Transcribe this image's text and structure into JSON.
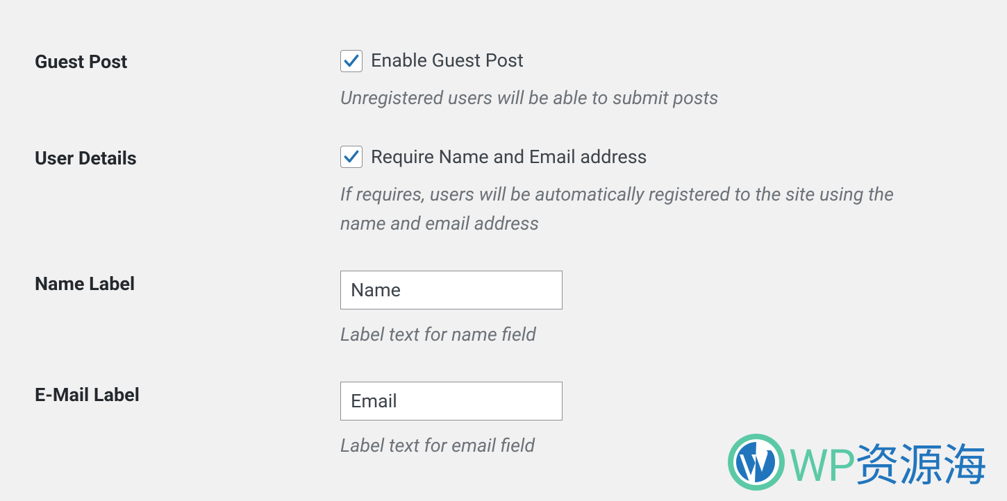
{
  "rows": {
    "guest_post": {
      "label": "Guest Post",
      "checkbox_label": "Enable Guest Post",
      "description": "Unregistered users will be able to submit posts"
    },
    "user_details": {
      "label": "User Details",
      "checkbox_label": "Require Name and Email address",
      "description": "If requires, users will be automatically registered to the site using the name and email address"
    },
    "name_label": {
      "label": "Name Label",
      "value": "Name",
      "description": "Label text for name field"
    },
    "email_label": {
      "label": "E-Mail Label",
      "value": "Email",
      "description": "Label text for email field"
    }
  },
  "logo": {
    "wp": "WP",
    "cn": "资源海"
  }
}
